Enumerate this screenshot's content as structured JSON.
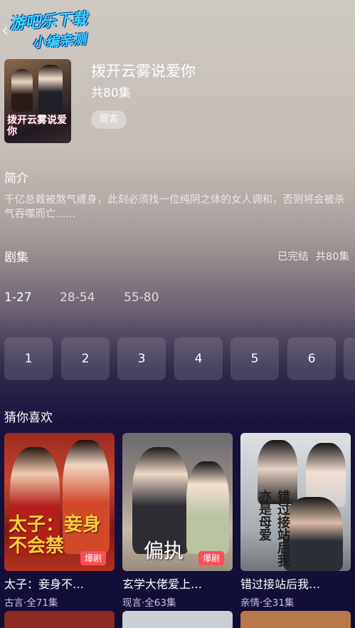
{
  "watermark": {
    "line1": "游吧乐下载",
    "line2": "小编亲测"
  },
  "drama": {
    "title": "拨开云雾说爱你",
    "total_episodes": "共80集",
    "tag": "现言",
    "poster_title": "拨开云雾说爱你"
  },
  "intro": {
    "heading": "简介",
    "text": "千亿总裁被煞气缠身，此刻必须找一位纯阴之体的女人调和，否则将会被杀气吞噬而亡......"
  },
  "episodes": {
    "heading": "剧集",
    "status": "已完结",
    "count": "共80集",
    "ranges": [
      "1-27",
      "28-54",
      "55-80"
    ],
    "active_range": "1-27",
    "buttons": [
      "1",
      "2",
      "3",
      "4",
      "5",
      "6"
    ]
  },
  "recommend": {
    "heading": "猜你喜欢",
    "cards": [
      {
        "title": "太子：妾身不…",
        "meta": "古言·全71集",
        "badge": "爆剧",
        "cover_text": "太子：妾身不会禁"
      },
      {
        "title": "玄学大佬爱上…",
        "meta": "现言·全63集",
        "badge": "爆剧",
        "cover_text": "偏执"
      },
      {
        "title": "错过接站后我…",
        "meta": "亲情·全31集",
        "badge": "",
        "cover_text": "错过接站后我亦是母爱"
      }
    ]
  },
  "colors": {
    "badge": "#ff4d55",
    "watermark": "#40d8ff",
    "bg_bottom": "#110e36"
  }
}
